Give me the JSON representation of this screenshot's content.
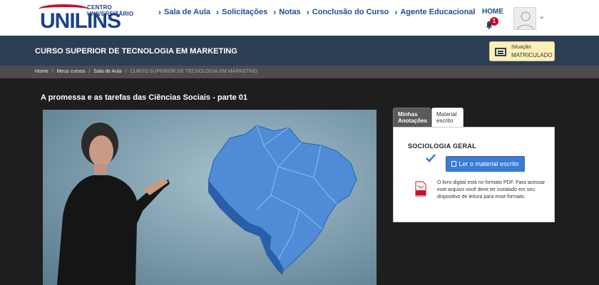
{
  "brand": {
    "small_text": "CENTRO UNIVERSITÁRIO",
    "name": "UNILINS",
    "accent_blue": "#1d3f8c",
    "accent_red": "#c8102e"
  },
  "nav": {
    "items": [
      {
        "label": "Sala de Aula"
      },
      {
        "label": "Solicitações"
      },
      {
        "label": "Notas"
      },
      {
        "label": "Conclusão do Curso"
      },
      {
        "label": "Agente Educacional"
      }
    ],
    "home_label": "HOME",
    "notification_count": "1"
  },
  "course": {
    "title": "CURSO SUPERIOR DE TECNOLOGIA EM MARKETING",
    "status_label": "Situação:",
    "status_value": "MATRICULADO"
  },
  "breadcrumb": {
    "items": [
      "Home",
      "Meus cursos",
      "Sala de Aula",
      "CURSO SUPERIOR DE TECNOLOGIA EM MARKETING"
    ]
  },
  "lesson": {
    "title": "A promessa e as tarefas das Ciências Sociais - parte 01"
  },
  "side_panel": {
    "tab_notes": "Minhas Anotações",
    "tab_material": "Material escrito",
    "subject": "SOCIOLOGIA GERAL",
    "read_button": "Ler o material escrito",
    "pdf_note": "O livro digital está no formato PDF. Para acessar este arquivo você deve ter instalado em seu dispositivo de leitura para esse formato."
  }
}
